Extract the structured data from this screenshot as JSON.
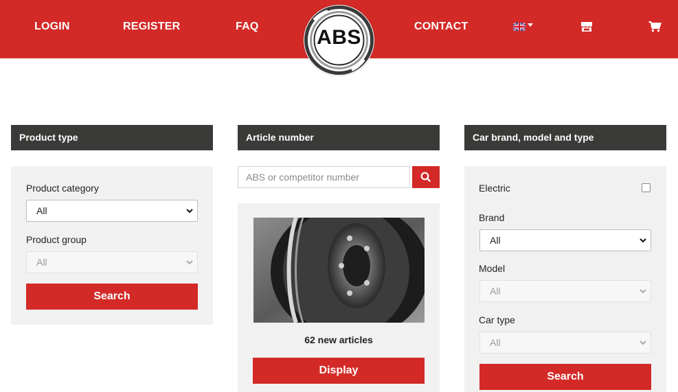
{
  "nav": {
    "login": "LOGIN",
    "register": "REGISTER",
    "faq": "FAQ",
    "contact": "CONTACT",
    "logo_text": "ABS",
    "language_icon": "uk-flag-icon",
    "store_icon": "store-icon",
    "cart_icon": "cart-icon"
  },
  "colors": {
    "brand_red": "#d32a27",
    "header_dark": "#3a3a38",
    "panel_bg": "#f1f1f1"
  },
  "product_type": {
    "heading": "Product type",
    "category_label": "Product category",
    "category_value": "All",
    "group_label": "Product group",
    "group_value": "All",
    "search_label": "Search"
  },
  "article_number": {
    "heading": "Article number",
    "search_placeholder": "ABS or competitor number",
    "search_icon": "search-icon",
    "new_articles_text": "62 new articles",
    "display_label": "Display"
  },
  "car": {
    "heading": "Car brand, model and type",
    "electric_label": "Electric",
    "electric_checked": false,
    "brand_label": "Brand",
    "brand_value": "All",
    "model_label": "Model",
    "model_value": "All",
    "cartype_label": "Car type",
    "cartype_value": "All",
    "search_label": "Search"
  }
}
